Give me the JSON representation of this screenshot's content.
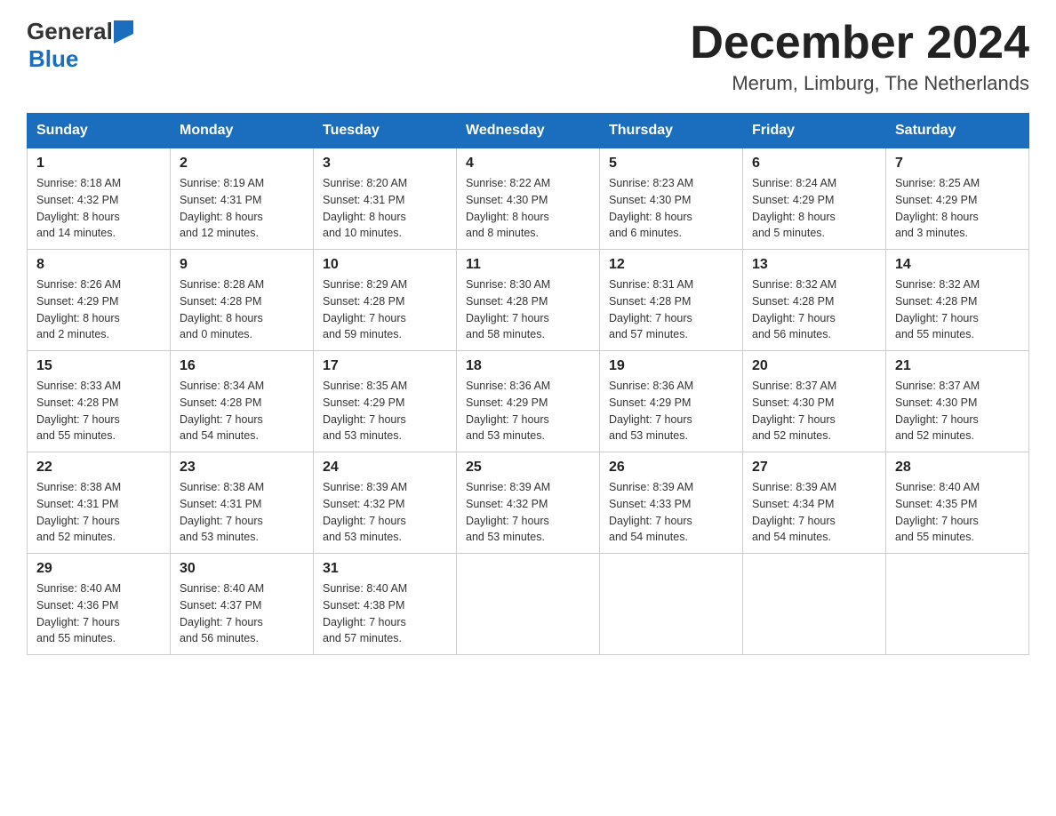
{
  "header": {
    "logo_general": "General",
    "logo_blue": "Blue",
    "month": "December 2024",
    "location": "Merum, Limburg, The Netherlands"
  },
  "weekdays": [
    "Sunday",
    "Monday",
    "Tuesday",
    "Wednesday",
    "Thursday",
    "Friday",
    "Saturday"
  ],
  "weeks": [
    [
      {
        "day": "1",
        "sunrise": "Sunrise: 8:18 AM",
        "sunset": "Sunset: 4:32 PM",
        "daylight": "Daylight: 8 hours",
        "daylight2": "and 14 minutes."
      },
      {
        "day": "2",
        "sunrise": "Sunrise: 8:19 AM",
        "sunset": "Sunset: 4:31 PM",
        "daylight": "Daylight: 8 hours",
        "daylight2": "and 12 minutes."
      },
      {
        "day": "3",
        "sunrise": "Sunrise: 8:20 AM",
        "sunset": "Sunset: 4:31 PM",
        "daylight": "Daylight: 8 hours",
        "daylight2": "and 10 minutes."
      },
      {
        "day": "4",
        "sunrise": "Sunrise: 8:22 AM",
        "sunset": "Sunset: 4:30 PM",
        "daylight": "Daylight: 8 hours",
        "daylight2": "and 8 minutes."
      },
      {
        "day": "5",
        "sunrise": "Sunrise: 8:23 AM",
        "sunset": "Sunset: 4:30 PM",
        "daylight": "Daylight: 8 hours",
        "daylight2": "and 6 minutes."
      },
      {
        "day": "6",
        "sunrise": "Sunrise: 8:24 AM",
        "sunset": "Sunset: 4:29 PM",
        "daylight": "Daylight: 8 hours",
        "daylight2": "and 5 minutes."
      },
      {
        "day": "7",
        "sunrise": "Sunrise: 8:25 AM",
        "sunset": "Sunset: 4:29 PM",
        "daylight": "Daylight: 8 hours",
        "daylight2": "and 3 minutes."
      }
    ],
    [
      {
        "day": "8",
        "sunrise": "Sunrise: 8:26 AM",
        "sunset": "Sunset: 4:29 PM",
        "daylight": "Daylight: 8 hours",
        "daylight2": "and 2 minutes."
      },
      {
        "day": "9",
        "sunrise": "Sunrise: 8:28 AM",
        "sunset": "Sunset: 4:28 PM",
        "daylight": "Daylight: 8 hours",
        "daylight2": "and 0 minutes."
      },
      {
        "day": "10",
        "sunrise": "Sunrise: 8:29 AM",
        "sunset": "Sunset: 4:28 PM",
        "daylight": "Daylight: 7 hours",
        "daylight2": "and 59 minutes."
      },
      {
        "day": "11",
        "sunrise": "Sunrise: 8:30 AM",
        "sunset": "Sunset: 4:28 PM",
        "daylight": "Daylight: 7 hours",
        "daylight2": "and 58 minutes."
      },
      {
        "day": "12",
        "sunrise": "Sunrise: 8:31 AM",
        "sunset": "Sunset: 4:28 PM",
        "daylight": "Daylight: 7 hours",
        "daylight2": "and 57 minutes."
      },
      {
        "day": "13",
        "sunrise": "Sunrise: 8:32 AM",
        "sunset": "Sunset: 4:28 PM",
        "daylight": "Daylight: 7 hours",
        "daylight2": "and 56 minutes."
      },
      {
        "day": "14",
        "sunrise": "Sunrise: 8:32 AM",
        "sunset": "Sunset: 4:28 PM",
        "daylight": "Daylight: 7 hours",
        "daylight2": "and 55 minutes."
      }
    ],
    [
      {
        "day": "15",
        "sunrise": "Sunrise: 8:33 AM",
        "sunset": "Sunset: 4:28 PM",
        "daylight": "Daylight: 7 hours",
        "daylight2": "and 55 minutes."
      },
      {
        "day": "16",
        "sunrise": "Sunrise: 8:34 AM",
        "sunset": "Sunset: 4:28 PM",
        "daylight": "Daylight: 7 hours",
        "daylight2": "and 54 minutes."
      },
      {
        "day": "17",
        "sunrise": "Sunrise: 8:35 AM",
        "sunset": "Sunset: 4:29 PM",
        "daylight": "Daylight: 7 hours",
        "daylight2": "and 53 minutes."
      },
      {
        "day": "18",
        "sunrise": "Sunrise: 8:36 AM",
        "sunset": "Sunset: 4:29 PM",
        "daylight": "Daylight: 7 hours",
        "daylight2": "and 53 minutes."
      },
      {
        "day": "19",
        "sunrise": "Sunrise: 8:36 AM",
        "sunset": "Sunset: 4:29 PM",
        "daylight": "Daylight: 7 hours",
        "daylight2": "and 53 minutes."
      },
      {
        "day": "20",
        "sunrise": "Sunrise: 8:37 AM",
        "sunset": "Sunset: 4:30 PM",
        "daylight": "Daylight: 7 hours",
        "daylight2": "and 52 minutes."
      },
      {
        "day": "21",
        "sunrise": "Sunrise: 8:37 AM",
        "sunset": "Sunset: 4:30 PM",
        "daylight": "Daylight: 7 hours",
        "daylight2": "and 52 minutes."
      }
    ],
    [
      {
        "day": "22",
        "sunrise": "Sunrise: 8:38 AM",
        "sunset": "Sunset: 4:31 PM",
        "daylight": "Daylight: 7 hours",
        "daylight2": "and 52 minutes."
      },
      {
        "day": "23",
        "sunrise": "Sunrise: 8:38 AM",
        "sunset": "Sunset: 4:31 PM",
        "daylight": "Daylight: 7 hours",
        "daylight2": "and 53 minutes."
      },
      {
        "day": "24",
        "sunrise": "Sunrise: 8:39 AM",
        "sunset": "Sunset: 4:32 PM",
        "daylight": "Daylight: 7 hours",
        "daylight2": "and 53 minutes."
      },
      {
        "day": "25",
        "sunrise": "Sunrise: 8:39 AM",
        "sunset": "Sunset: 4:32 PM",
        "daylight": "Daylight: 7 hours",
        "daylight2": "and 53 minutes."
      },
      {
        "day": "26",
        "sunrise": "Sunrise: 8:39 AM",
        "sunset": "Sunset: 4:33 PM",
        "daylight": "Daylight: 7 hours",
        "daylight2": "and 54 minutes."
      },
      {
        "day": "27",
        "sunrise": "Sunrise: 8:39 AM",
        "sunset": "Sunset: 4:34 PM",
        "daylight": "Daylight: 7 hours",
        "daylight2": "and 54 minutes."
      },
      {
        "day": "28",
        "sunrise": "Sunrise: 8:40 AM",
        "sunset": "Sunset: 4:35 PM",
        "daylight": "Daylight: 7 hours",
        "daylight2": "and 55 minutes."
      }
    ],
    [
      {
        "day": "29",
        "sunrise": "Sunrise: 8:40 AM",
        "sunset": "Sunset: 4:36 PM",
        "daylight": "Daylight: 7 hours",
        "daylight2": "and 55 minutes."
      },
      {
        "day": "30",
        "sunrise": "Sunrise: 8:40 AM",
        "sunset": "Sunset: 4:37 PM",
        "daylight": "Daylight: 7 hours",
        "daylight2": "and 56 minutes."
      },
      {
        "day": "31",
        "sunrise": "Sunrise: 8:40 AM",
        "sunset": "Sunset: 4:38 PM",
        "daylight": "Daylight: 7 hours",
        "daylight2": "and 57 minutes."
      },
      null,
      null,
      null,
      null
    ]
  ]
}
